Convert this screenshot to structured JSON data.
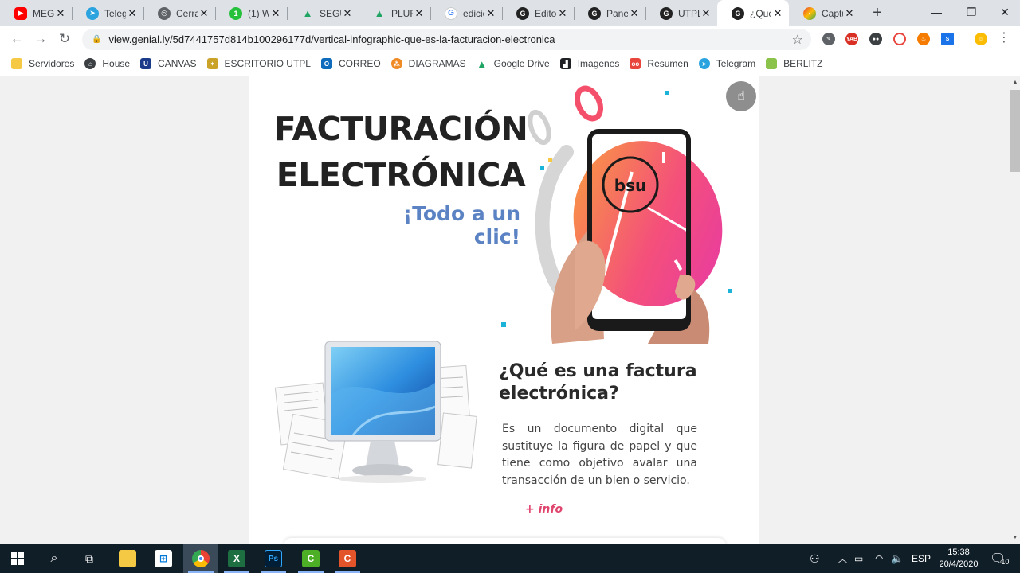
{
  "browser": {
    "tabs": [
      {
        "title": "MEGA",
        "icon": "youtube-icon",
        "color": "#ff0000"
      },
      {
        "title": "Teleg",
        "icon": "telegram-icon",
        "color": "#2aa3df"
      },
      {
        "title": "Cerra",
        "icon": "globe-icon",
        "color": "#5f6368"
      },
      {
        "title": "(1) W",
        "icon": "whatsapp-icon",
        "color": "#25c03c"
      },
      {
        "title": "SEGU",
        "icon": "google-drive-icon",
        "color": "#1fa463"
      },
      {
        "title": "PLUR",
        "icon": "google-drive-icon",
        "color": "#1fa463"
      },
      {
        "title": "edicio",
        "icon": "google-icon",
        "color": "#4285f4"
      },
      {
        "title": "Edito",
        "icon": "genially-icon",
        "color": "#e91e3c"
      },
      {
        "title": "Panel",
        "icon": "genially-icon",
        "color": "#e91e3c"
      },
      {
        "title": "UTPL",
        "icon": "genially-icon",
        "color": "#e91e3c"
      },
      {
        "title": "¿Qué",
        "icon": "genially-icon",
        "color": "#e91e3c",
        "active": true
      },
      {
        "title": "Captu",
        "icon": "capture-icon",
        "color": "#f4b400"
      }
    ],
    "address": "view.genial.ly/5d7441757d814b100296177d/vertical-infographic-que-es-la-facturacion-electronica",
    "bookmarks": [
      {
        "label": "Servidores",
        "icon": "folder-icon",
        "color": "#f6c945"
      },
      {
        "label": "House",
        "icon": "house-icon",
        "color": "#3c4043"
      },
      {
        "label": "CANVAS",
        "icon": "canvas-icon",
        "color": "#1b3a8a"
      },
      {
        "label": "ESCRITORIO UTPL",
        "icon": "utpl-icon",
        "color": "#c9a227"
      },
      {
        "label": "CORREO",
        "icon": "outlook-icon",
        "color": "#0f6cbd"
      },
      {
        "label": "DIAGRAMAS",
        "icon": "diagram-icon",
        "color": "#f08a24"
      },
      {
        "label": "Google Drive",
        "icon": "google-drive-icon",
        "color": "#1fa463"
      },
      {
        "label": "Imagenes",
        "icon": "image-icon",
        "color": "#202124"
      },
      {
        "label": "Resumen",
        "icon": "resumen-icon",
        "color": "#e8453c"
      },
      {
        "label": "Telegram",
        "icon": "telegram-icon",
        "color": "#2aa3df"
      },
      {
        "label": "BERLITZ",
        "icon": "berlitz-icon",
        "color": "#8bc34a"
      }
    ]
  },
  "page": {
    "headline_line1": "FACTURACIÓN",
    "headline_line2": "ELECTRÓNICA",
    "tagline": "¡Todo a un clic!",
    "phone_logo": "bsu",
    "section_title": "¿Qué es una factura electrónica?",
    "section_body": "Es un documento digital que sustituye la figura de papel y que tiene como objetivo avalar una transacción de un bien o servicio.",
    "more_link": "+ info"
  },
  "taskbar": {
    "language": "ESP",
    "time": "15:38",
    "date": "20/4/2020",
    "notification_count": "10"
  },
  "colors": {
    "accent_pink": "#e0456e",
    "tagline_blue": "#5b83c4",
    "taskbar_bg": "#101e28"
  }
}
